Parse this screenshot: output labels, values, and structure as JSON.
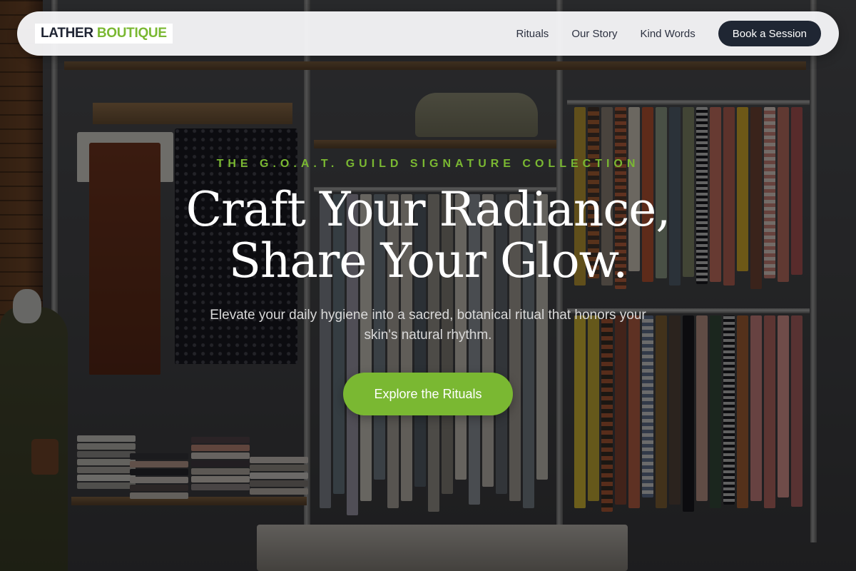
{
  "brand": {
    "name_part1": "LATHER",
    "name_part2": "BOUTIQUE"
  },
  "nav": {
    "links": [
      {
        "label": "Rituals"
      },
      {
        "label": "Our Story"
      },
      {
        "label": "Kind Words"
      }
    ],
    "cta_label": "Book a Session"
  },
  "hero": {
    "eyebrow": "THE G.O.A.T. GUILD SIGNATURE COLLECTION",
    "headline_line1": "Craft Your Radiance,",
    "headline_line2": "Share Your Glow.",
    "subtext": "Elevate your daily hygiene into a sacred, botanical ritual that honors your skin's natural rhythm.",
    "cta_label": "Explore the Rituals",
    "background_image": "clothing-boutique-interior"
  },
  "colors": {
    "accent": "#7ab832",
    "navbar_bg": "#f5f5f7",
    "dark_button": "#1f2633",
    "headline": "#ffffff"
  }
}
